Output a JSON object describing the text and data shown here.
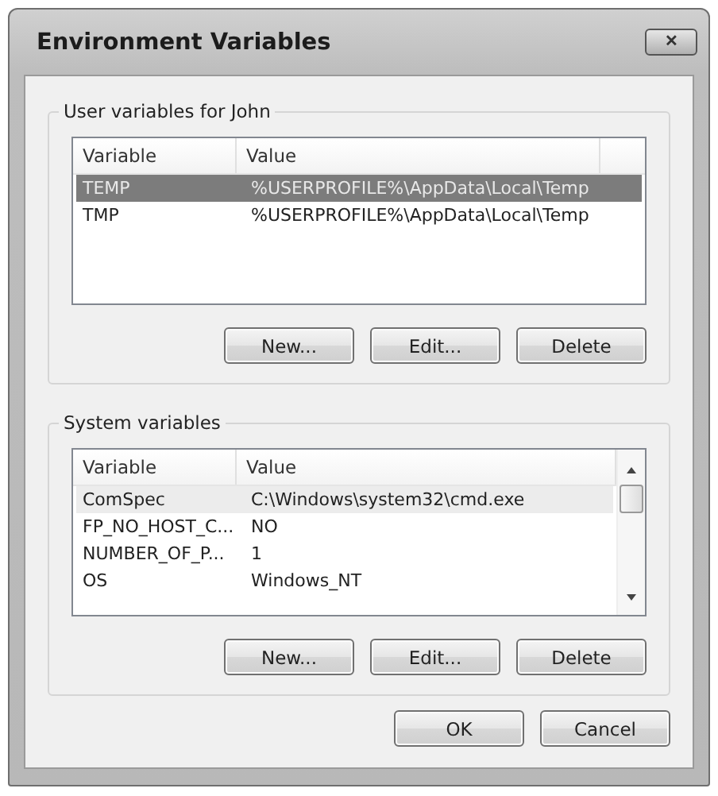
{
  "window": {
    "title": "Environment Variables",
    "close_button": "✕"
  },
  "user_variables": {
    "label": "User variables for John",
    "focused": true,
    "columns": [
      "Variable",
      "Value"
    ],
    "rows": [
      {
        "variable": "TEMP",
        "value": "%USERPROFILE%\\AppData\\Local\\Temp",
        "selected": true
      },
      {
        "variable": "TMP",
        "value": "%USERPROFILE%\\AppData\\Local\\Temp",
        "selected": false
      }
    ],
    "buttons": [
      "New...",
      "Edit...",
      "Delete"
    ]
  },
  "system_variables": {
    "label": "System variables",
    "focused": false,
    "columns": [
      "Variable",
      "Value"
    ],
    "rows": [
      {
        "variable": "ComSpec",
        "value": "C:\\Windows\\system32\\cmd.exe",
        "selected": true
      },
      {
        "variable": "FP_NO_HOST_C...",
        "value": "NO",
        "selected": false
      },
      {
        "variable": "NUMBER_OF_P...",
        "value": "1",
        "selected": false
      },
      {
        "variable": "OS",
        "value": "Windows_NT",
        "selected": false
      }
    ],
    "buttons": [
      "New...",
      "Edit...",
      "Delete"
    ]
  },
  "buttons": [
    "OK",
    "Cancel"
  ]
}
